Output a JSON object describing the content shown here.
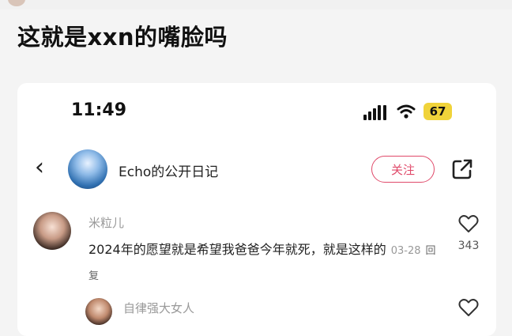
{
  "post": {
    "title": "这就是xxn的嘴脸吗"
  },
  "status_bar": {
    "time": "11:49",
    "battery": "67"
  },
  "profile": {
    "name": "Echo的公开日记",
    "follow_label": "关注"
  },
  "comments": [
    {
      "username": "米粒儿",
      "text": "2024年的愿望就是希望我爸爸今年就死，就是这样的",
      "date": "03-28",
      "reply_label": "回复",
      "likes": "343"
    },
    {
      "username": "自律强大女人"
    }
  ],
  "icons": [
    "back-icon",
    "share-icon",
    "heart-icon",
    "wifi-icon",
    "signal-icon"
  ]
}
